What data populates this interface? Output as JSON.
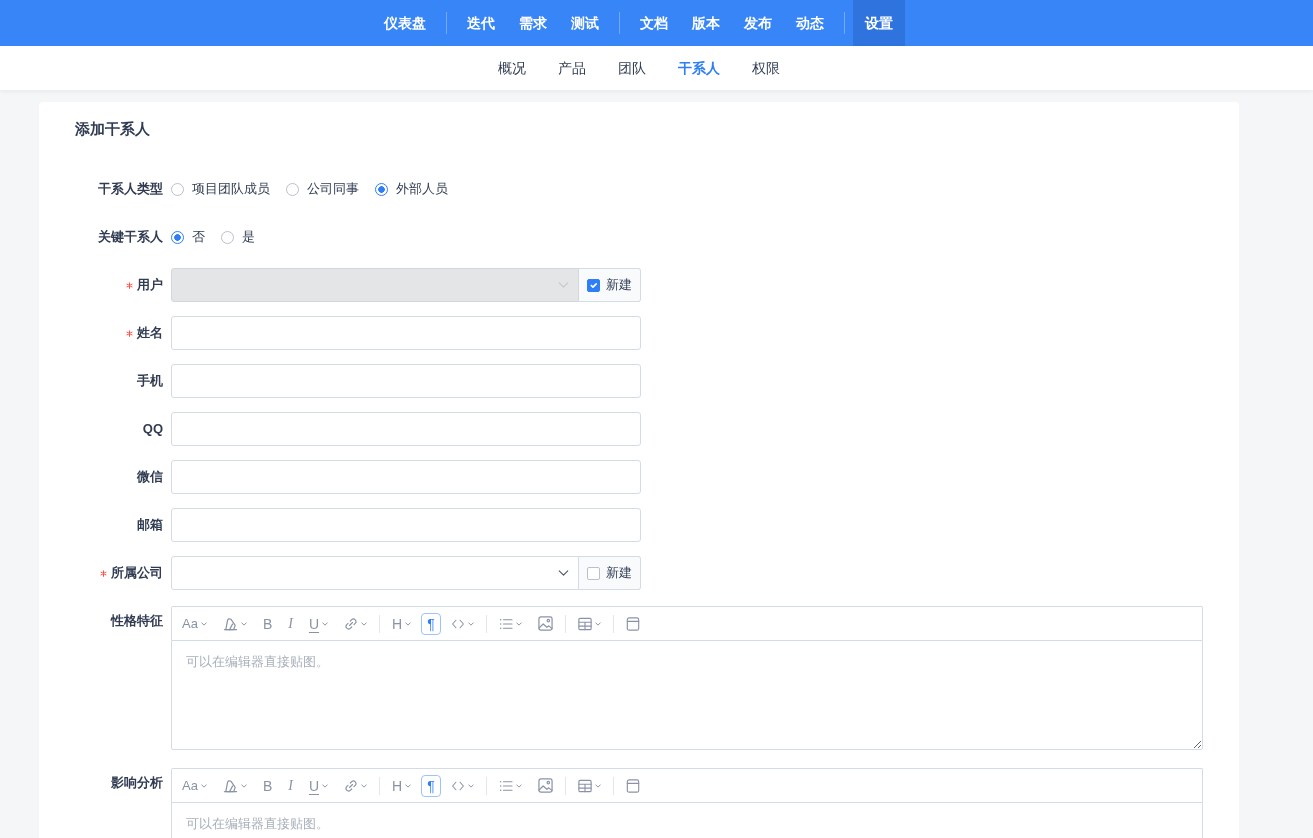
{
  "top_nav": {
    "groups": [
      [
        {
          "label": "仪表盘",
          "selected": false
        }
      ],
      [
        {
          "label": "迭代",
          "selected": false
        },
        {
          "label": "需求",
          "selected": false
        },
        {
          "label": "测试",
          "selected": false
        }
      ],
      [
        {
          "label": "文档",
          "selected": false
        },
        {
          "label": "版本",
          "selected": false
        },
        {
          "label": "发布",
          "selected": false
        },
        {
          "label": "动态",
          "selected": false
        }
      ],
      [
        {
          "label": "设置",
          "selected": true
        }
      ]
    ]
  },
  "sub_nav": {
    "items": [
      {
        "label": "概况",
        "selected": false
      },
      {
        "label": "产品",
        "selected": false
      },
      {
        "label": "团队",
        "selected": false
      },
      {
        "label": "干系人",
        "selected": true
      },
      {
        "label": "权限",
        "selected": false
      }
    ]
  },
  "form": {
    "title": "添加干系人",
    "fields": [
      {
        "kind": "radio",
        "label": "干系人类型",
        "required": false,
        "options": [
          {
            "label": "项目团队成员",
            "selected": false
          },
          {
            "label": "公司同事",
            "selected": false
          },
          {
            "label": "外部人员",
            "selected": true
          }
        ]
      },
      {
        "kind": "radio",
        "label": "关键干系人",
        "required": false,
        "options": [
          {
            "label": "否",
            "selected": true
          },
          {
            "label": "是",
            "selected": false
          }
        ]
      },
      {
        "kind": "select",
        "label": "用户",
        "required": true,
        "disabled": true,
        "addon": {
          "label": "新建",
          "checked": true
        }
      },
      {
        "kind": "text",
        "label": "姓名",
        "required": true,
        "disabled": false
      },
      {
        "kind": "text",
        "label": "手机",
        "required": false,
        "disabled": false
      },
      {
        "kind": "text",
        "label": "QQ",
        "required": false,
        "disabled": false
      },
      {
        "kind": "text",
        "label": "微信",
        "required": false,
        "disabled": false
      },
      {
        "kind": "text",
        "label": "邮箱",
        "required": false,
        "disabled": false
      },
      {
        "kind": "select",
        "label": "所属公司",
        "required": true,
        "disabled": false,
        "addon": {
          "label": "新建",
          "checked": false
        }
      },
      {
        "kind": "editor",
        "label": "性格特征",
        "required": false,
        "placeholder": "可以在编辑器直接贴图。",
        "toolbar": [
          {
            "kind": "font",
            "label": "Aa",
            "caret": true,
            "active": false
          },
          {
            "kind": "highlighter",
            "caret": true,
            "active": false
          },
          {
            "kind": "bold",
            "label": "B",
            "caret": false,
            "active": false
          },
          {
            "kind": "italic",
            "label": "I",
            "caret": false,
            "active": false
          },
          {
            "kind": "underline",
            "label": "U",
            "caret": true,
            "active": false
          },
          {
            "kind": "link",
            "caret": true,
            "active": false
          },
          {
            "kind": "divider"
          },
          {
            "kind": "heading",
            "label": "H",
            "caret": true,
            "active": false
          },
          {
            "kind": "paragraph",
            "label": "¶",
            "caret": false,
            "active": true
          },
          {
            "kind": "code",
            "caret": true,
            "active": false
          },
          {
            "kind": "divider"
          },
          {
            "kind": "list",
            "caret": true,
            "active": false
          },
          {
            "kind": "image",
            "caret": false,
            "active": false
          },
          {
            "kind": "divider"
          },
          {
            "kind": "table",
            "caret": true,
            "active": false
          },
          {
            "kind": "divider"
          },
          {
            "kind": "layout",
            "caret": false,
            "active": false
          }
        ]
      },
      {
        "kind": "editor",
        "label": "影响分析",
        "required": false,
        "placeholder": "可以在编辑器直接贴图。",
        "toolbar": [
          {
            "kind": "font",
            "label": "Aa",
            "caret": true,
            "active": false
          },
          {
            "kind": "highlighter",
            "caret": true,
            "active": false
          },
          {
            "kind": "bold",
            "label": "B",
            "caret": false,
            "active": false
          },
          {
            "kind": "italic",
            "label": "I",
            "caret": false,
            "active": false
          },
          {
            "kind": "underline",
            "label": "U",
            "caret": true,
            "active": false
          },
          {
            "kind": "link",
            "caret": true,
            "active": false
          },
          {
            "kind": "divider"
          },
          {
            "kind": "heading",
            "label": "H",
            "caret": true,
            "active": false
          },
          {
            "kind": "paragraph",
            "label": "¶",
            "caret": false,
            "active": true
          },
          {
            "kind": "code",
            "caret": true,
            "active": false
          },
          {
            "kind": "divider"
          },
          {
            "kind": "list",
            "caret": true,
            "active": false
          },
          {
            "kind": "image",
            "caret": false,
            "active": false
          },
          {
            "kind": "divider"
          },
          {
            "kind": "table",
            "caret": true,
            "active": false
          },
          {
            "kind": "divider"
          },
          {
            "kind": "layout",
            "caret": false,
            "active": false
          }
        ]
      }
    ]
  }
}
